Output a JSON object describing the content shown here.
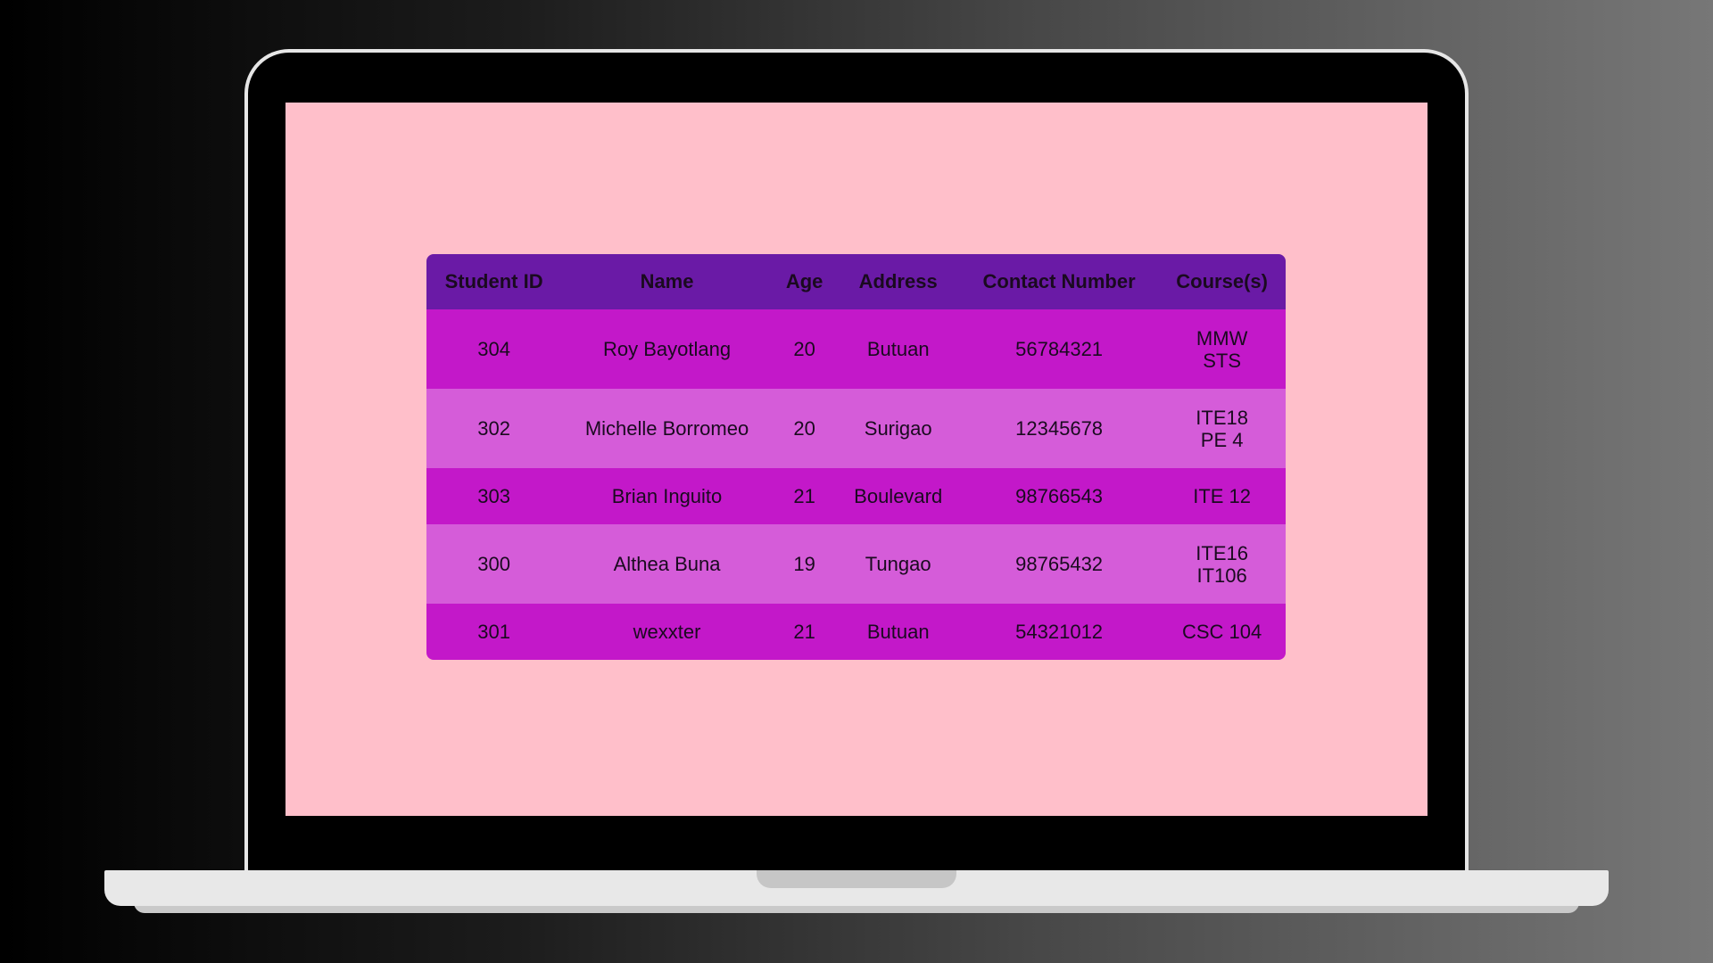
{
  "table": {
    "headers": [
      "Student ID",
      "Name",
      "Age",
      "Address",
      "Contact Number",
      "Course(s)"
    ],
    "rows": [
      {
        "id": "304",
        "name": "Roy Bayotlang",
        "age": "20",
        "address": "Butuan",
        "contact": "56784321",
        "courses": [
          "MMW",
          "STS"
        ]
      },
      {
        "id": "302",
        "name": "Michelle Borromeo",
        "age": "20",
        "address": "Surigao",
        "contact": "12345678",
        "courses": [
          "ITE18",
          "PE 4"
        ]
      },
      {
        "id": "303",
        "name": "Brian Inguito",
        "age": "21",
        "address": "Boulevard",
        "contact": "98766543",
        "courses": [
          "ITE 12"
        ]
      },
      {
        "id": "300",
        "name": "Althea Buna",
        "age": "19",
        "address": "Tungao",
        "contact": "98765432",
        "courses": [
          "ITE16",
          "IT106"
        ]
      },
      {
        "id": "301",
        "name": "wexxter",
        "age": "21",
        "address": "Butuan",
        "contact": "54321012",
        "courses": [
          "CSC 104"
        ]
      }
    ]
  },
  "colors": {
    "page_background": "#ffbfca",
    "header_row": "#6a1aa6",
    "row_odd": "#c318c9",
    "row_even": "#d55cd9"
  }
}
